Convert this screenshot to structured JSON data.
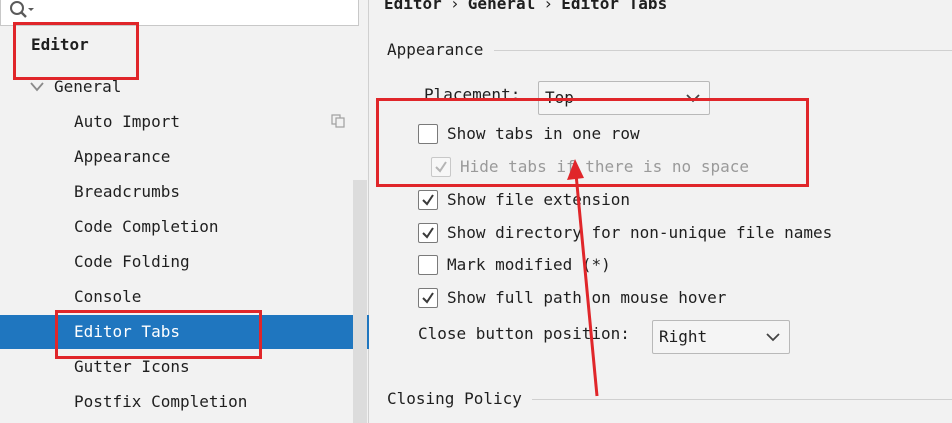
{
  "sidebar": {
    "tree": {
      "editor_label": "Editor",
      "general_label": "General",
      "items": [
        {
          "label": "Auto Import"
        },
        {
          "label": "Appearance"
        },
        {
          "label": "Breadcrumbs"
        },
        {
          "label": "Code Completion"
        },
        {
          "label": "Code Folding"
        },
        {
          "label": "Console"
        },
        {
          "label": "Editor Tabs",
          "selected": true
        },
        {
          "label": "Gutter Icons"
        },
        {
          "label": "Postfix Completion"
        }
      ]
    }
  },
  "breadcrumb": {
    "items": [
      "Editor",
      "General",
      "Editor Tabs"
    ],
    "separator": "›"
  },
  "appearance": {
    "section_title": "Appearance",
    "placement_label": "Placement:",
    "placement_value": "Top",
    "options": [
      {
        "label": "Show tabs in one row",
        "checked": false,
        "disabled": false
      },
      {
        "label": "Hide tabs if there is no space",
        "checked": true,
        "disabled": true
      },
      {
        "label": "Show file extension",
        "checked": true,
        "disabled": false
      },
      {
        "label": "Show directory for non-unique file names",
        "checked": true,
        "disabled": false
      },
      {
        "label": "Mark modified (*)",
        "checked": false,
        "disabled": false
      },
      {
        "label": "Show full path on mouse hover",
        "checked": true,
        "disabled": false
      }
    ],
    "close_button_label": "Close button position:",
    "close_button_value": "Right"
  },
  "closing_policy": {
    "section_title": "Closing Policy"
  },
  "colors": {
    "selection": "#1f76bf",
    "annotation": "#e0262a"
  }
}
